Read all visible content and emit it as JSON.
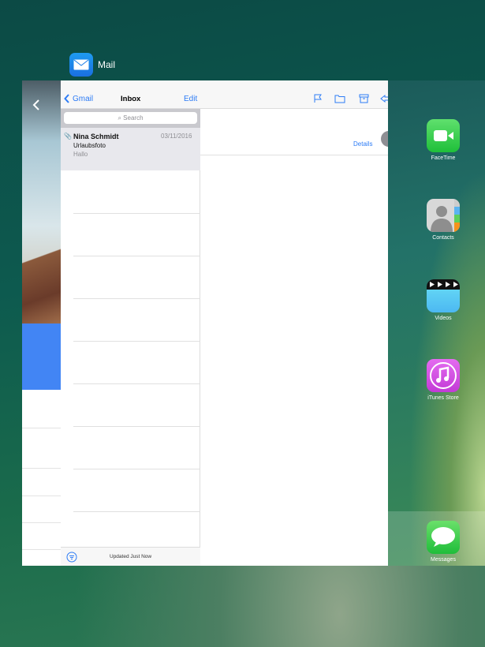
{
  "switcher": {
    "app_title": "Mail"
  },
  "mail": {
    "list_header": {
      "back_label": "Gmail",
      "title": "Inbox",
      "edit_label": "Edit"
    },
    "search_placeholder": "Search",
    "messages": [
      {
        "sender": "Nina Schmidt",
        "date": "03/11/2016",
        "subject": "Urlaubsfoto",
        "preview": "Hallo",
        "has_attachment": true
      }
    ],
    "footer_status": "Updated Just Now",
    "detail": {
      "details_link": "Details",
      "toolbar_icons": [
        "flag-icon",
        "folder-icon",
        "archive-icon",
        "reply-icon"
      ]
    }
  },
  "home_apps": [
    {
      "label": "FaceTime"
    },
    {
      "label": "Contacts"
    },
    {
      "label": "Videos"
    },
    {
      "label": "iTunes Store"
    }
  ],
  "dock_apps": [
    {
      "label": "Messages"
    }
  ],
  "colors": {
    "accent": "#2d7cf6",
    "photo_band": "#4285f4"
  }
}
